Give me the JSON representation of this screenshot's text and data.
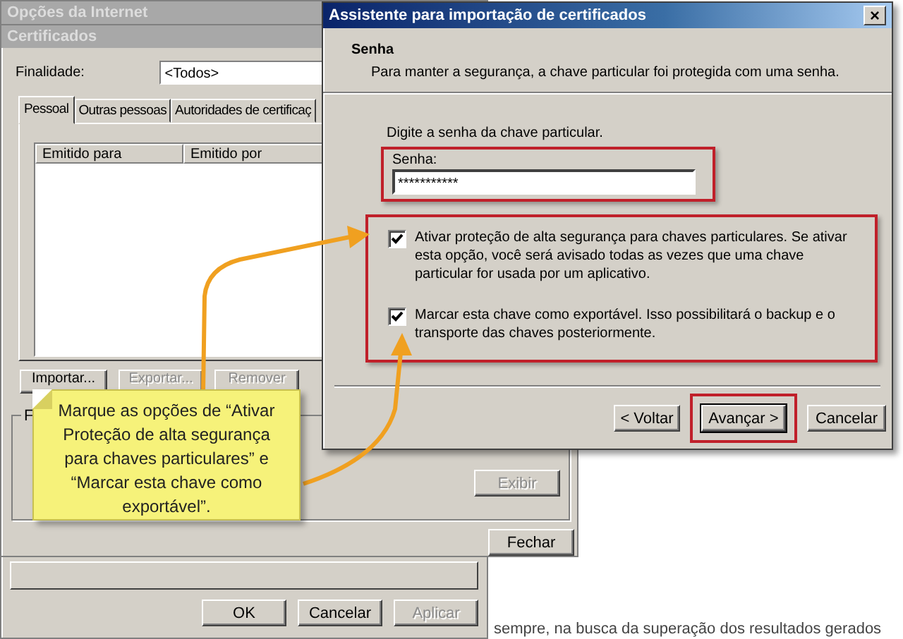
{
  "internet_options_window": {
    "title": "Opções da Internet",
    "buttons": [
      {
        "label": "OK",
        "disabled": false
      },
      {
        "label": "Cancelar",
        "disabled": false
      },
      {
        "label": "Aplicar",
        "disabled": true
      }
    ]
  },
  "certificates_window": {
    "title": "Certificados",
    "purpose_label": "Finalidade:",
    "purpose_value": "<Todos>",
    "tabs": [
      {
        "label": "Pessoal",
        "selected": true
      },
      {
        "label": "Outras pessoas",
        "selected": false
      },
      {
        "label": "Autoridades de certificaç",
        "selected": false
      }
    ],
    "columns": [
      "Emitido para",
      "Emitido por"
    ],
    "buttons": [
      {
        "label": "Importar...",
        "disabled": false
      },
      {
        "label": "Exportar...",
        "disabled": true
      },
      {
        "label": "Remover",
        "disabled": true
      }
    ],
    "group_label": "F",
    "view_button": {
      "label": "Exibir",
      "disabled": true
    },
    "close_button": {
      "label": "Fechar",
      "disabled": false
    }
  },
  "wizard": {
    "title": "Assistente para importação de certificados",
    "close": "×",
    "section_title": "Senha",
    "section_subtitle": "Para manter a segurança, a chave particular foi protegida com uma senha.",
    "prompt": "Digite a senha da chave particular.",
    "password_label": "Senha:",
    "password_value": "***********",
    "options": [
      {
        "text": "Ativar proteção de alta segurança para chaves particulares. Se ativar esta opção, você será avisado todas as vezes que uma chave particular for usada por um aplicativo.",
        "checked": true
      },
      {
        "text": "Marcar esta chave como exportável. Isso possibilitará o backup e o transporte das chaves posteriormente.",
        "checked": true
      }
    ],
    "buttons": [
      {
        "label": "< Voltar",
        "highlighted": false
      },
      {
        "label": "Avançar >",
        "highlighted": true
      },
      {
        "label": "Cancelar",
        "highlighted": false
      }
    ]
  },
  "callout": {
    "text": "Marque as opções de “Ativar Proteção de alta segurança para chaves particulares” e “Marcar esta chave como exportável”."
  },
  "page_text": "sempre, na busca da superação dos resultados gerados"
}
